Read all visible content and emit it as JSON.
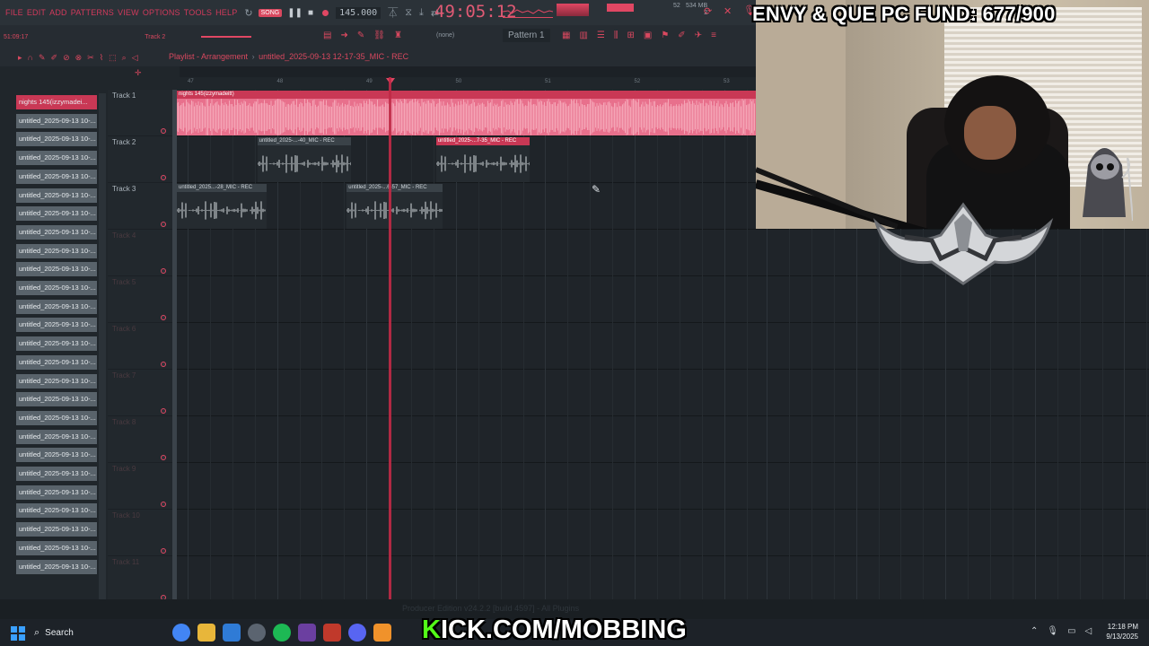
{
  "menu": [
    "FILE",
    "EDIT",
    "ADD",
    "PATTERNS",
    "VIEW",
    "OPTIONS",
    "TOOLS",
    "HELP"
  ],
  "transport": {
    "song_label": "SONG",
    "tempo": "145.000",
    "time": "49:05:12",
    "memory": "534 MB",
    "memory_sub": "2",
    "cpu_value": "52"
  },
  "toolbar2": {
    "clock": "51:09:17",
    "track_hint": "Track 2",
    "none_label": "(none)",
    "pattern": "Pattern 1"
  },
  "playlist": {
    "title": "Playlist - Arrangement",
    "separator": "›",
    "subtitle": "untitled_2025-09-13 12-17-35_MIC - REC",
    "ruler": [
      "47",
      "48",
      "49",
      "50",
      "51",
      "52",
      "53"
    ]
  },
  "clip_picker": [
    "nights 145(izzymadei...",
    "untitled_2025-09-13 10-...",
    "untitled_2025-09-13 10-...",
    "untitled_2025-09-13 10-...",
    "untitled_2025-09-13 10-...",
    "untitled_2025-09-13 10-...",
    "untitled_2025-09-13 10-...",
    "untitled_2025-09-13 10-...",
    "untitled_2025-09-13 10-...",
    "untitled_2025-09-13 10-...",
    "untitled_2025-09-13 10-...",
    "untitled_2025-09-13 10-...",
    "untitled_2025-09-13 10-...",
    "untitled_2025-09-13 10-...",
    "untitled_2025-09-13 10-...",
    "untitled_2025-09-13 10-...",
    "untitled_2025-09-13 10-...",
    "untitled_2025-09-13 10-...",
    "untitled_2025-09-13 10-...",
    "untitled_2025-09-13 10-...",
    "untitled_2025-09-13 10-...",
    "untitled_2025-09-13 10-...",
    "untitled_2025-09-13 10-...",
    "untitled_2025-09-13 10-...",
    "untitled_2025-09-13 10-...",
    "untitled_2025-09-13 10-..."
  ],
  "tracks": [
    "Track 1",
    "Track 2",
    "Track 3",
    "Track 4",
    "Track 5",
    "Track 6",
    "Track 7",
    "Track 8",
    "Track 9",
    "Track 10",
    "Track 11"
  ],
  "clips": [
    {
      "track": 0,
      "label": "nights 145(izzymadeitt)",
      "kind": "audio-red",
      "start_beat": 0,
      "len_beats": 26
    },
    {
      "track": 1,
      "label": "untitled_2025-...-40_MIC - REC",
      "kind": "mic",
      "start_beat": 3.6,
      "len_beats": 4.2
    },
    {
      "track": 1,
      "label": "untitled_2025-...7-35_MIC - REC",
      "kind": "mic sel",
      "start_beat": 11.6,
      "len_beats": 4.2
    },
    {
      "track": 2,
      "label": "untitled_2025...-28_MIC - REC",
      "kind": "mic",
      "start_beat": 0,
      "len_beats": 4
    },
    {
      "track": 2,
      "label": "untitled_2025-...6-57_MIC - REC",
      "kind": "mic",
      "start_beat": 7.6,
      "len_beats": 4.3
    }
  ],
  "overlay": {
    "fund": "ENVY & QUE PC FUND: 677/900",
    "kick_k": "K",
    "kick_rest": "ICK.COM/MOBBING"
  },
  "status": {
    "build": "Producer Edition v24.2.2 [build 4597] - All Plugins"
  },
  "taskbar": {
    "search_label": "Search",
    "time": "12:18 PM",
    "date": "9/13/2025"
  },
  "colors": {
    "accent": "#e04763",
    "kick_green": "#53fc18"
  }
}
